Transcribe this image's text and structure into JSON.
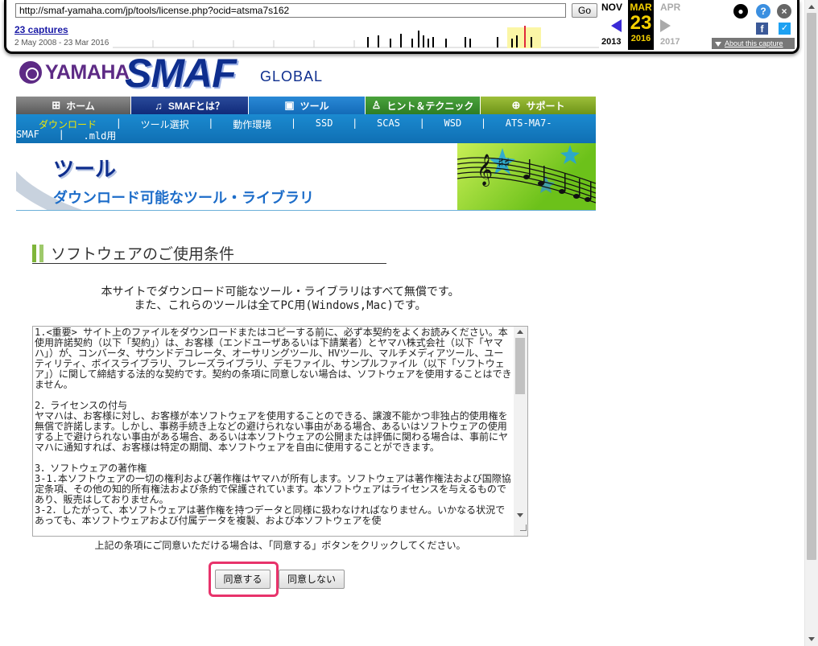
{
  "wayback": {
    "url": "http://smaf-yamaha.com/jp/tools/license.php?ocid=atsma7s162",
    "go_label": "Go",
    "captures_label": "23 captures",
    "date_range": "2 May 2008 - 23 Mar 2016",
    "prev_month": "NOV",
    "prev_year": "2013",
    "cur_month": "MAR",
    "cur_day": "23",
    "cur_year": "2016",
    "next_month": "APR",
    "next_year": "2017",
    "about_label": "About this capture",
    "icons": [
      "user-icon",
      "help-icon",
      "close-icon",
      "facebook-icon",
      "twitter-icon"
    ]
  },
  "logo": {
    "brand": "YAMAHA",
    "product": "SMAF",
    "suffix": "GLOBAL"
  },
  "nav": {
    "home": "ホーム",
    "about": "SMAFとは？",
    "tools": "ツール",
    "hints": "ヒント＆テクニック",
    "support": "サポート"
  },
  "subnav": {
    "download": "ダウンロード",
    "tool_select": "ツール選択",
    "env": "動作環境",
    "ssd": "SSD",
    "scas": "SCAS",
    "wsd": "WSD",
    "ats_a": "ATS-MA7-",
    "ats_b": "SMAF",
    "mld": ".mld用"
  },
  "banner": {
    "title": "ツール",
    "subtitle": "ダウンロード可能なツール・ライブラリ"
  },
  "section": {
    "title": "ソフトウェアのご使用条件",
    "intro_line1": "本サイトでダウンロード可能なツール・ライブラリはすべて無償です。",
    "intro_line2": "また、これらのツールは全てPC用(Windows,Mac)です。",
    "terms": "1.<重要> サイト上のファイルをダウンロードまたはコピーする前に、必ず本契約をよくお読みください。本使用許諾契約（以下「契約」）は、お客様（エンドユーザあるいは下請業者）とヤマハ株式会社（以下「ヤマハ」）が、コンバータ、サウンドデコレータ、オーサリングツール、HVツール、マルチメディアツール、ユーティリティ、ボイスライブラリ、フレーズライブラリ、デモファイル、サンプルファイル（以下「ソフトウェア」）に関して締結する法的な契約です。契約の条項に同意しない場合は、ソフトウェアを使用することはできません。\n\n2．ライセンスの付与\nヤマハは、お客様に対し、お客様が本ソフトウェアを使用することのできる、譲渡不能かつ非独占的使用権を無償で許諾します。しかし、事務手続き上などの避けられない事由がある場合、あるいはソフトウェアの使用する上で避けられない事由がある場合、あるいは本ソフトウェアの公開または評価に関わる場合は、事前にヤマハに通知すれば、お客様は特定の期間、本ソフトウェアを自由に使用することができます。\n\n3．ソフトウェアの著作権\n3-1.本ソフトウェアの一切の権利および著作権はヤマハが所有します。ソフトウェアは著作権法および国際協定条項、その他の知的所有権法および条約で保護されています。本ソフトウェアはライセンスを与えるものであり、販売はしておりません。\n3-2．したがって、本ソフトウェアは著作権を持つデータと同様に扱わなければなりません。いかなる状況であっても、本ソフトウェアおよび付属データを複製、および本ソフトウェアを使",
    "agree_note": "上記の条項にご同意いただける場合は、「同意する」ボタンをクリックしてください。"
  },
  "buttons": {
    "agree": "同意する",
    "disagree": "同意しない"
  },
  "colors": {
    "brand_purple": "#5d2a85",
    "brand_navy": "#0e2e8e",
    "highlight": "#e8336b"
  }
}
